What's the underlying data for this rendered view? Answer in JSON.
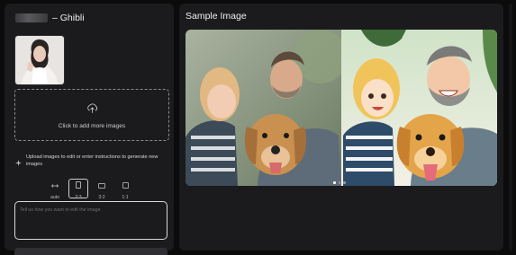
{
  "app": {
    "title": "– Ghibli"
  },
  "upload": {
    "label": "Click to add more images"
  },
  "hint": {
    "text": "Upload images to edit or enter instructions to generate new images"
  },
  "ratios": [
    {
      "label": "auto",
      "selected": false
    },
    {
      "label": "2:3",
      "selected": true
    },
    {
      "label": "3:2",
      "selected": false
    },
    {
      "label": "1:1",
      "selected": false
    }
  ],
  "prompt": {
    "placeholder": "Tell us how you want to edit the image",
    "value": ""
  },
  "sample": {
    "title": "Sample Image"
  },
  "carousel": {
    "count": 3,
    "active": 0
  },
  "colors": {
    "panel": "#1b1b1d",
    "background": "#0b0b0c",
    "border": "#d9d9dc"
  },
  "icons": [
    "upload-cloud-icon",
    "sparkle-icon",
    "aspect-auto-icon",
    "aspect-portrait-icon",
    "aspect-landscape-icon",
    "aspect-square-icon"
  ]
}
